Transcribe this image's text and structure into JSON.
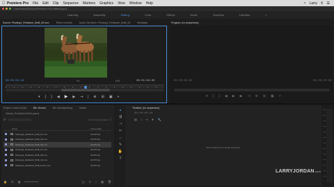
{
  "menubar": {
    "items": [
      "Premiere Pro",
      "File",
      "Edit",
      "Clip",
      "Sequence",
      "Markers",
      "Graphics",
      "View",
      "Window",
      "Help"
    ],
    "user": "Larry"
  },
  "titlebar": {
    "path": "/Users/larry/Desktop/Premiere Pro/Untitled.prproj"
  },
  "workspaces": {
    "items": [
      "Learning",
      "Assembly",
      "Editing",
      "Color",
      "Effects",
      "Audio",
      "Graphics",
      "Libraries"
    ],
    "active": "Editing"
  },
  "source": {
    "tabs": [
      "Source: Plowing1_Fieldwork_8mB_05.mov",
      "Effect Controls",
      "Audio Clip Mixer: Plowing1_Fieldwork_8mB_05",
      "Metadata"
    ],
    "timecode_in": "00:00:03:18",
    "fit": "Fit",
    "scale": "Full",
    "timecode_dur": "00:01:04:05"
  },
  "program": {
    "tab": "Program: (no sequences)",
    "timecode_left": "00:00:00:00",
    "timecode_right": "00:00:00:00"
  },
  "project": {
    "tabs": [
      "Project: Learn to Edit",
      "Bin: Horses",
      "Bin: Woodworking",
      "Media"
    ],
    "title": "Horses_ProductionCube.prproj",
    "item_count": "1 of 7 items selected",
    "col_name": "Name",
    "col_rate": "Frame Rate",
    "rows": [
      {
        "name": "Plowing1_Fieldwork_8mB_02.mov",
        "rate": "23.976 fps"
      },
      {
        "name": "Plowing1_Fieldwork_8mB_03.mov",
        "rate": "23.976 fps"
      },
      {
        "name": "Plowing1_Fieldwork_8mB_05.mov",
        "rate": "23.976 fps"
      },
      {
        "name": "Plowing1_Fieldwork_8mB_07.mov",
        "rate": "23.976 fps"
      },
      {
        "name": "Plowing1_Fieldwork_8mB_09.mov",
        "rate": "23.976 fps"
      },
      {
        "name": "Plowing1_Fieldwork_8mB_10.mov",
        "rate": "23.976 fps"
      },
      {
        "name": "Plowing1_Fieldwork_8mB_Horse.mov",
        "rate": "23.976 fps"
      }
    ],
    "selected_index": 2
  },
  "timeline": {
    "tab": "Timeline: (no sequences)",
    "timecode": "00:00:00:00",
    "empty_message": "Drop media here to create sequence."
  },
  "watermark": {
    "brand": "LARRYJORDAN",
    "domain": ".com"
  },
  "colors": {
    "accent": "#4a8cd8",
    "menubar": "#dcdcdc",
    "panel": "#222222"
  }
}
